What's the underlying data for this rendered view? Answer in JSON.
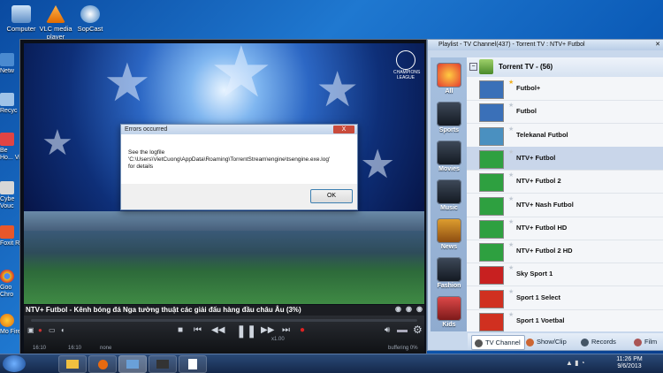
{
  "desktop": {
    "icons": [
      {
        "label": "Computer"
      },
      {
        "label": "VLC media player"
      },
      {
        "label": "SopCast"
      }
    ],
    "left_labels": [
      "Netw",
      "Recyc",
      "Be Ho... Vi",
      "Cybe Vouc",
      "Foxit R",
      "Goo Chro",
      "Mo Fire"
    ]
  },
  "player": {
    "channel_info": "NTV+ Futbol - Kênh bóng đá Nga tường thuật các giải đấu hàng đầu châu Âu (3%)",
    "logo_text": "CHAMPIONS LEAGUE",
    "time_left": "16:10",
    "time_right": "16:10",
    "none_label": "none",
    "speed": "x1.00",
    "status": "buffering 0%"
  },
  "dialog": {
    "title": "Errors occurred",
    "close": "X",
    "line1": "See the logfile",
    "line2": "'C:\\Users\\VietCuong\\AppData\\Roaming\\TorrentStream\\engine\\tsengine.exe.log'",
    "line3": "for details",
    "ok_label": "OK"
  },
  "playlist": {
    "title": "Playlist - TV Channel(437) - Torrent TV : NTV+ Futbol",
    "group": "Torrent TV - (56)",
    "categories": [
      "All",
      "Sports",
      "Movies",
      "Music",
      "News",
      "Fashion",
      "Kids"
    ],
    "channels": [
      {
        "name": "Futbol+"
      },
      {
        "name": "Futbol"
      },
      {
        "name": "Telekanal Futbol"
      },
      {
        "name": "NTV+ Futbol"
      },
      {
        "name": "NTV+ Futbol 2"
      },
      {
        "name": "NTV+ Nash Futbol"
      },
      {
        "name": "NTV+ Futbol HD"
      },
      {
        "name": "NTV+ Futbol 2 HD"
      },
      {
        "name": "Sky Sport 1"
      },
      {
        "name": "Sport 1 Select"
      },
      {
        "name": "Sport 1 Voetbal"
      }
    ],
    "tabs": [
      "TV Channel",
      "Show/Clip",
      "Records",
      "Film"
    ]
  },
  "taskbar": {
    "time": "11:26 PM",
    "date": "9/6/2013"
  }
}
